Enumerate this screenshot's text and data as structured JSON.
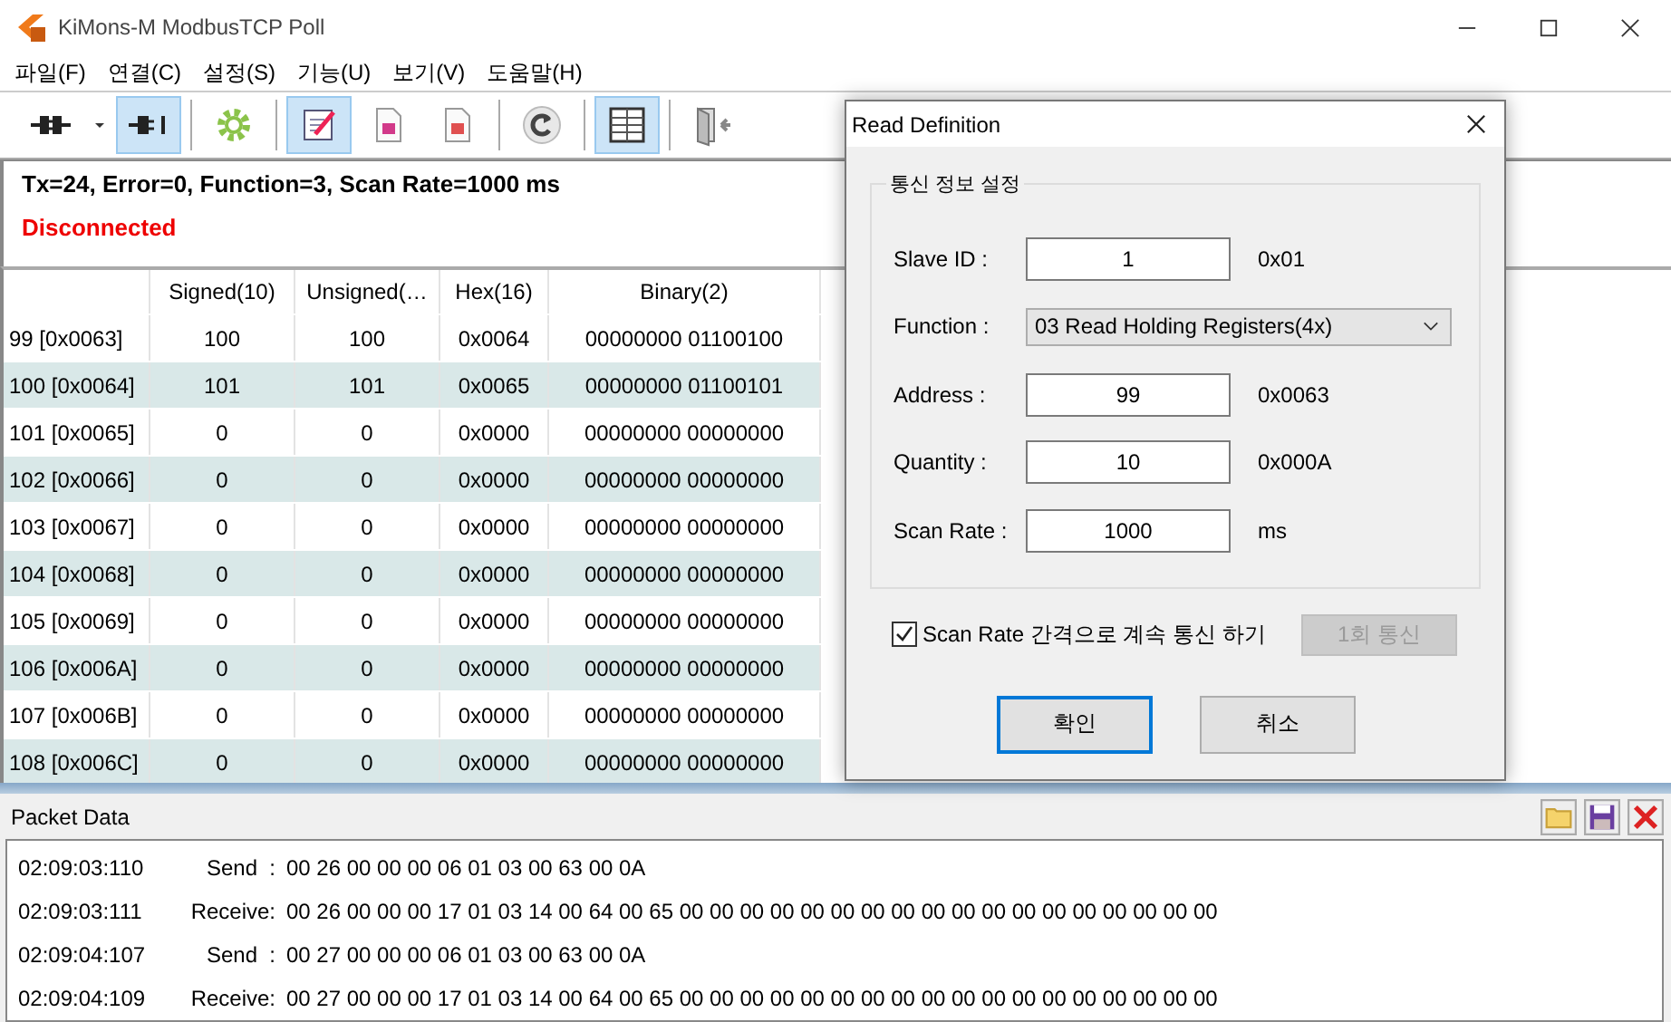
{
  "window": {
    "title": "KiMons-M ModbusTCP Poll"
  },
  "menu": [
    "파일(F)",
    "연결(C)",
    "설정(S)",
    "기능(U)",
    "보기(V)",
    "도움말(H)"
  ],
  "toolbar": [
    {
      "kind": "plug",
      "pressed": false
    },
    {
      "kind": "dropdown",
      "pressed": false
    },
    {
      "kind": "unplug",
      "pressed": true
    },
    {
      "kind": "sep"
    },
    {
      "kind": "gear",
      "pressed": false
    },
    {
      "kind": "sep"
    },
    {
      "kind": "edit",
      "pressed": true
    },
    {
      "kind": "doc-b",
      "pressed": false
    },
    {
      "kind": "doc-w",
      "pressed": false
    },
    {
      "kind": "sep"
    },
    {
      "kind": "refresh",
      "pressed": false
    },
    {
      "kind": "sep"
    },
    {
      "kind": "table",
      "pressed": true
    },
    {
      "kind": "sep"
    },
    {
      "kind": "exit",
      "pressed": false
    }
  ],
  "status": {
    "summary": "Tx=24, Error=0, Function=3, Scan Rate=1000 ms",
    "connection": "Disconnected"
  },
  "table": {
    "columns": [
      "",
      "Signed(10)",
      "Unsigned(…",
      "Hex(16)",
      "Binary(2)"
    ],
    "rows": [
      [
        "99 [0x0063]",
        "100",
        "100",
        "0x0064",
        "00000000 01100100"
      ],
      [
        "100 [0x0064]",
        "101",
        "101",
        "0x0065",
        "00000000 01100101"
      ],
      [
        "101 [0x0065]",
        "0",
        "0",
        "0x0000",
        "00000000 00000000"
      ],
      [
        "102 [0x0066]",
        "0",
        "0",
        "0x0000",
        "00000000 00000000"
      ],
      [
        "103 [0x0067]",
        "0",
        "0",
        "0x0000",
        "00000000 00000000"
      ],
      [
        "104 [0x0068]",
        "0",
        "0",
        "0x0000",
        "00000000 00000000"
      ],
      [
        "105 [0x0069]",
        "0",
        "0",
        "0x0000",
        "00000000 00000000"
      ],
      [
        "106 [0x006A]",
        "0",
        "0",
        "0x0000",
        "00000000 00000000"
      ],
      [
        "107 [0x006B]",
        "0",
        "0",
        "0x0000",
        "00000000 00000000"
      ],
      [
        "108 [0x006C]",
        "0",
        "0",
        "0x0000",
        "00000000 00000000"
      ]
    ]
  },
  "packet_data": {
    "title": "Packet Data",
    "lines": [
      {
        "time": "02:09:03:110",
        "direction": "Send  :",
        "data": "00 26 00 00 00 06 01 03 00 63 00 0A"
      },
      {
        "time": "02:09:03:111",
        "direction": "Receive:",
        "data": "00 26 00 00 00 17 01 03 14 00 64 00 65 00 00 00 00 00 00 00 00 00 00 00 00 00 00 00 00 00 00"
      },
      {
        "time": "02:09:04:107",
        "direction": "Send  :",
        "data": "00 27 00 00 00 06 01 03 00 63 00 0A"
      },
      {
        "time": "02:09:04:109",
        "direction": "Receive:",
        "data": "00 27 00 00 00 17 01 03 14 00 64 00 65 00 00 00 00 00 00 00 00 00 00 00 00 00 00 00 00 00 00"
      }
    ]
  },
  "dialog": {
    "title": "Read Definition",
    "group": "통신 정보 설정",
    "fields": [
      {
        "kind": "input",
        "label": "Slave ID :",
        "value": "1",
        "note": "0x01"
      },
      {
        "kind": "select",
        "label": "Function :",
        "value": "03 Read Holding Registers(4x)"
      },
      {
        "kind": "input",
        "label": "Address :",
        "value": "99",
        "note": "0x0063"
      },
      {
        "kind": "input",
        "label": "Quantity :",
        "value": "10",
        "note": "0x000A"
      },
      {
        "kind": "input",
        "label": "Scan Rate :",
        "value": "1000",
        "note": "ms"
      }
    ],
    "continuous": {
      "label": "Scan Rate 간격으로 계속 통신 하기",
      "checked": true
    },
    "once_button": {
      "label": "1회 통신",
      "disabled": true
    },
    "buttons": [
      {
        "label": "확인",
        "focused": true
      },
      {
        "label": "취소",
        "focused": false
      }
    ]
  }
}
